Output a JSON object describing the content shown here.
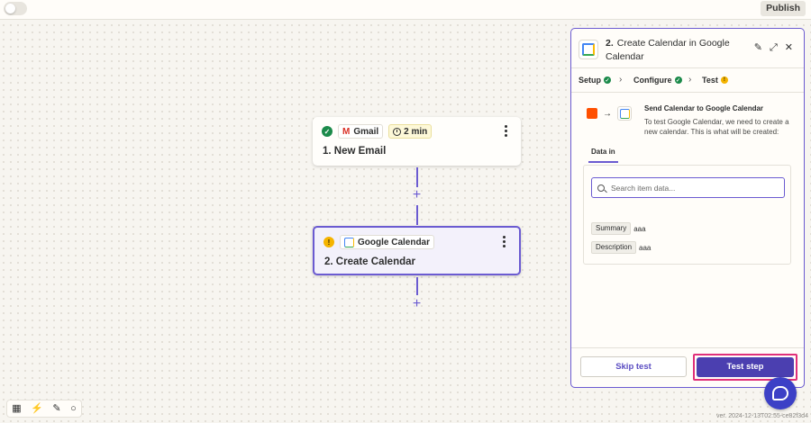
{
  "topbar": {
    "publish_label": "Publish"
  },
  "steps": [
    {
      "app": "Gmail",
      "time": "2 min",
      "title": "1. New Email",
      "status": "complete"
    },
    {
      "app": "Google Calendar",
      "title": "2. Create Calendar",
      "status": "warning"
    }
  ],
  "panel": {
    "step_number": "2.",
    "title": "Create Calendar in Google Calendar",
    "tabs": [
      {
        "label": "Setup",
        "status": "complete"
      },
      {
        "label": "Configure",
        "status": "complete"
      },
      {
        "label": "Test",
        "status": "warning"
      }
    ],
    "send_title": "Send Calendar to Google Calendar",
    "send_description": "To test Google Calendar, we need to create a new calendar. This is what will be created:",
    "data_in_tab": "Data in",
    "search_placeholder": "Search item data...",
    "fields": [
      {
        "key": "Summary",
        "value": "aaa"
      },
      {
        "key": "Description",
        "value": "aaa"
      }
    ],
    "skip_label": "Skip test",
    "test_label": "Test step"
  },
  "footer": {
    "version": "ver. 2024-12-13T02:55-ce82f3d4"
  },
  "colors": {
    "accent": "#6b5bd1",
    "primary_button": "#4b3fb0",
    "highlight_border": "#e0307a",
    "success": "#1b8a4a",
    "warning": "#f5b400",
    "trigger_orange": "#ff4f00"
  }
}
